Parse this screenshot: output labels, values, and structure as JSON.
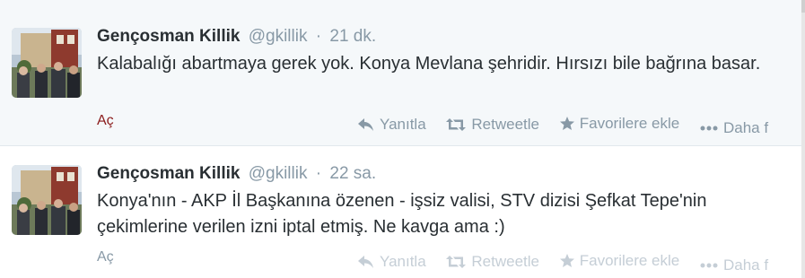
{
  "tweets": [
    {
      "name": "Gençosman Killik",
      "handle": "@gkillik",
      "separator": "·",
      "time": "21 dk.",
      "text": "Kalabalığı abartmaya gerek yok. Konya Mevlana şehridir. Hırsızı bile bağrına basar.",
      "expand": "Aç",
      "actions": {
        "reply": "Yanıtla",
        "retweet": "Retweetle",
        "favorite": "Favorilere ekle",
        "more": "Daha f"
      }
    },
    {
      "name": "Gençosman Killik",
      "handle": "@gkillik",
      "separator": "·",
      "time": "22 sa.",
      "text": "Konya'nın - AKP İl Başkanına özenen - işsiz valisi, STV dizisi Şefkat Tepe'nin çekimlerine verilen izni iptal etmiş. Ne kavga ama :)",
      "expand": "Aç",
      "actions": {
        "reply": "Yanıtla",
        "retweet": "Retweetle",
        "favorite": "Favorilere ekle",
        "more": "Daha f"
      }
    }
  ],
  "icons": {
    "reply": "reply-icon",
    "retweet": "retweet-icon",
    "favorite": "star-icon",
    "more": "more-dots-icon"
  },
  "colors": {
    "name": "#292f33",
    "meta": "#8899a6",
    "expand_active": "#8b1c1c",
    "hover_background": "#f5f8fa"
  }
}
